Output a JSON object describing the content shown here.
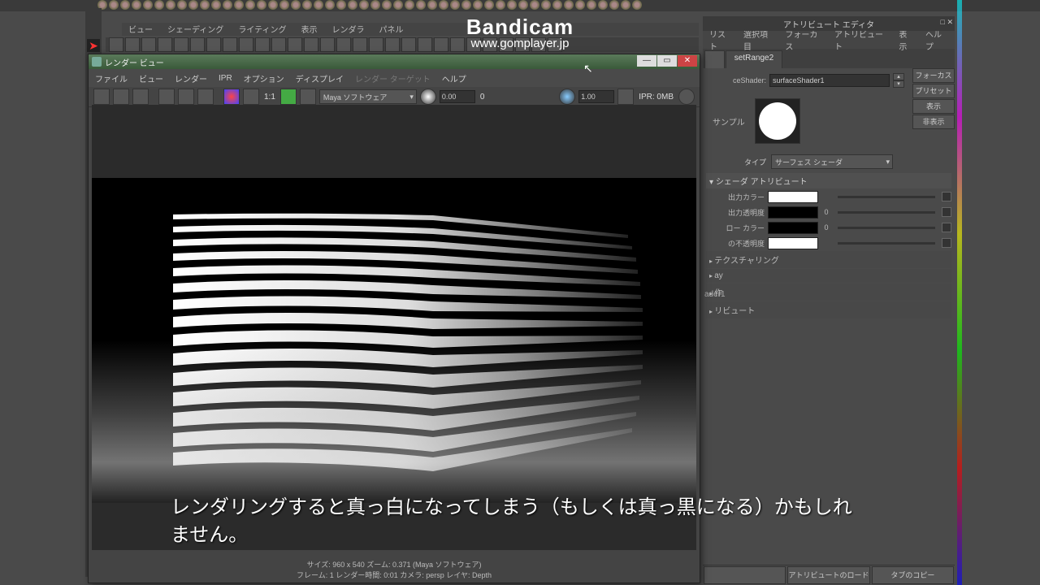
{
  "watermark": {
    "title": "Bandicam",
    "url": "www.gomplayer.jp"
  },
  "panel_menu": [
    "ビュー",
    "シェーディング",
    "ライティング",
    "表示",
    "レンダラ",
    "パネル"
  ],
  "render_view": {
    "title": "レンダー ビュー",
    "menu": [
      "ファイル",
      "ビュー",
      "レンダー",
      "IPR",
      "オプション",
      "ディスプレイ"
    ],
    "menu_dim": [
      "レンダー ターゲット"
    ],
    "menu_end": "ヘルプ",
    "ratio": "1:1",
    "renderer": "Maya ソフトウェア",
    "val_a": "0.00",
    "val_mid": "0",
    "val_b": "1.00",
    "ipr": "IPR: 0MB",
    "status1": "サイズ: 960 x 540   ズーム: 0.371   (Maya ソフトウェア)",
    "status2": "フレーム: 1   レンダー時間: 0:01   カメラ: persp   レイヤ: Depth"
  },
  "ae": {
    "title": "アトリビュート エディタ",
    "menu": [
      "リスト",
      "選択項目",
      "フォーカス",
      "アトリビュート",
      "表示",
      "ヘルプ"
    ],
    "tab": "setRange2",
    "side": [
      "フォーカス",
      "プリセット",
      "表示",
      "非表示"
    ],
    "shaderLabel": "ceShader:",
    "shaderValue": "surfaceShader1",
    "sample": "サンプル",
    "typeLabel": "タイプ",
    "typeValue": "サーフェス シェーダ",
    "section": "シェーダ アトリビュート",
    "attrs": [
      {
        "l": "出力カラー",
        "c": "#ffffff",
        "n": ""
      },
      {
        "l": "出力透明度",
        "c": "#000000",
        "n": "0"
      },
      {
        "l": "ロー カラー",
        "c": "#000000",
        "n": "0"
      },
      {
        "l": "の不透明度",
        "c": "#ffffff",
        "n": ""
      }
    ],
    "collapse": [
      "テクスチャリング",
      "ay",
      "作",
      "リビュート"
    ],
    "node": "ader1",
    "footer": [
      "",
      "アトリビュートのロード",
      "タブのコピー"
    ]
  },
  "subtitle": "レンダリングすると真っ白になってしまう（もしくは真っ黒になる）かもしれません。"
}
